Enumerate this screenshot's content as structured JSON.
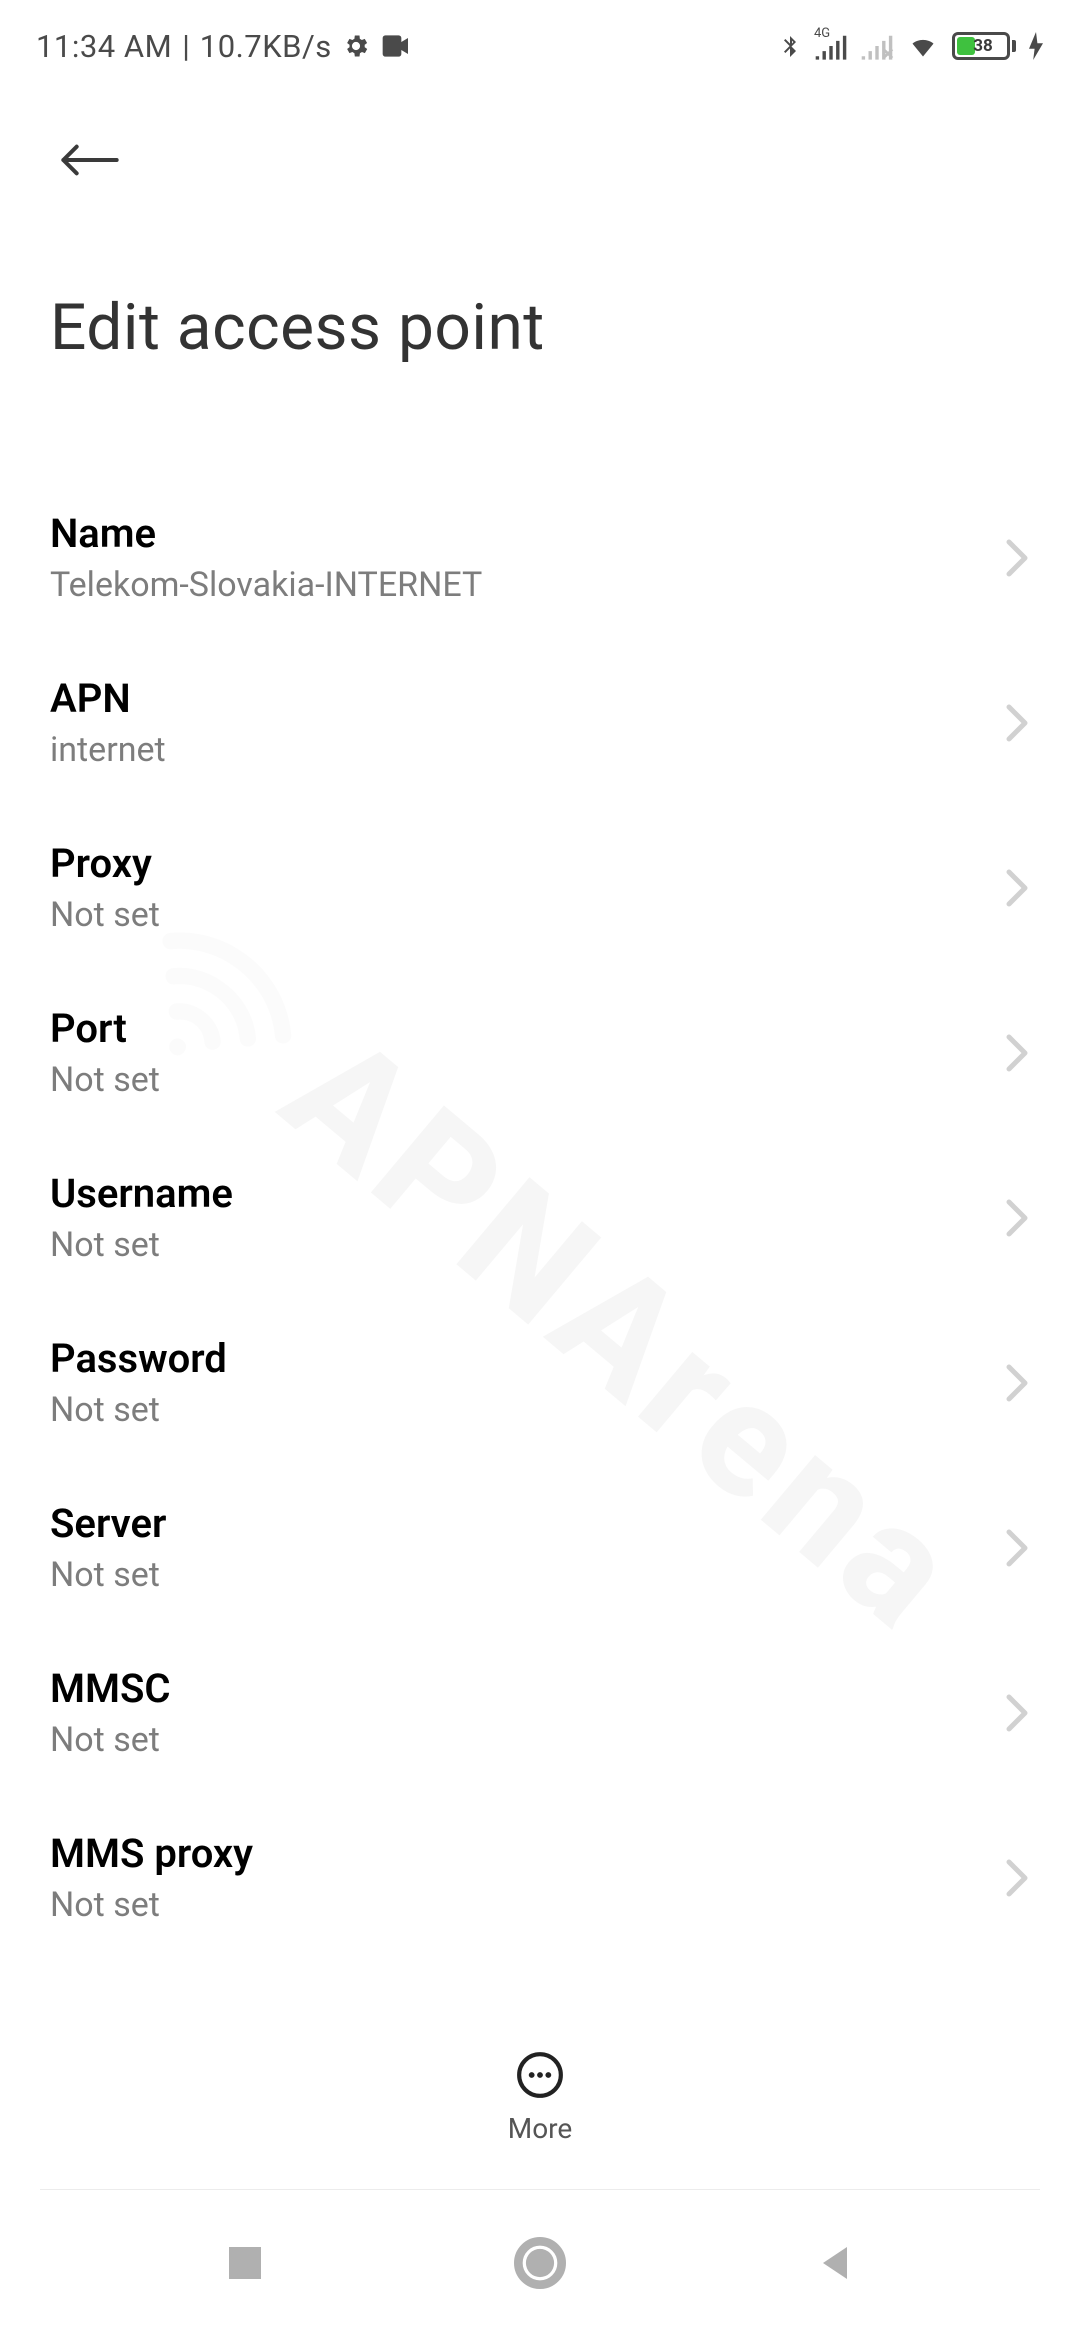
{
  "statusbar": {
    "time": "11:34 AM",
    "data_rate": "10.7KB/s",
    "battery_percent": 38
  },
  "header": {
    "title": "Edit access point"
  },
  "fields": [
    {
      "label": "Name",
      "value": "Telekom-Slovakia-INTERNET"
    },
    {
      "label": "APN",
      "value": "internet"
    },
    {
      "label": "Proxy",
      "value": "Not set"
    },
    {
      "label": "Port",
      "value": "Not set"
    },
    {
      "label": "Username",
      "value": "Not set"
    },
    {
      "label": "Password",
      "value": "Not set"
    },
    {
      "label": "Server",
      "value": "Not set"
    },
    {
      "label": "MMSC",
      "value": "Not set"
    },
    {
      "label": "MMS proxy",
      "value": "Not set"
    }
  ],
  "bottom": {
    "more_label": "More"
  },
  "watermark": "APNArena"
}
